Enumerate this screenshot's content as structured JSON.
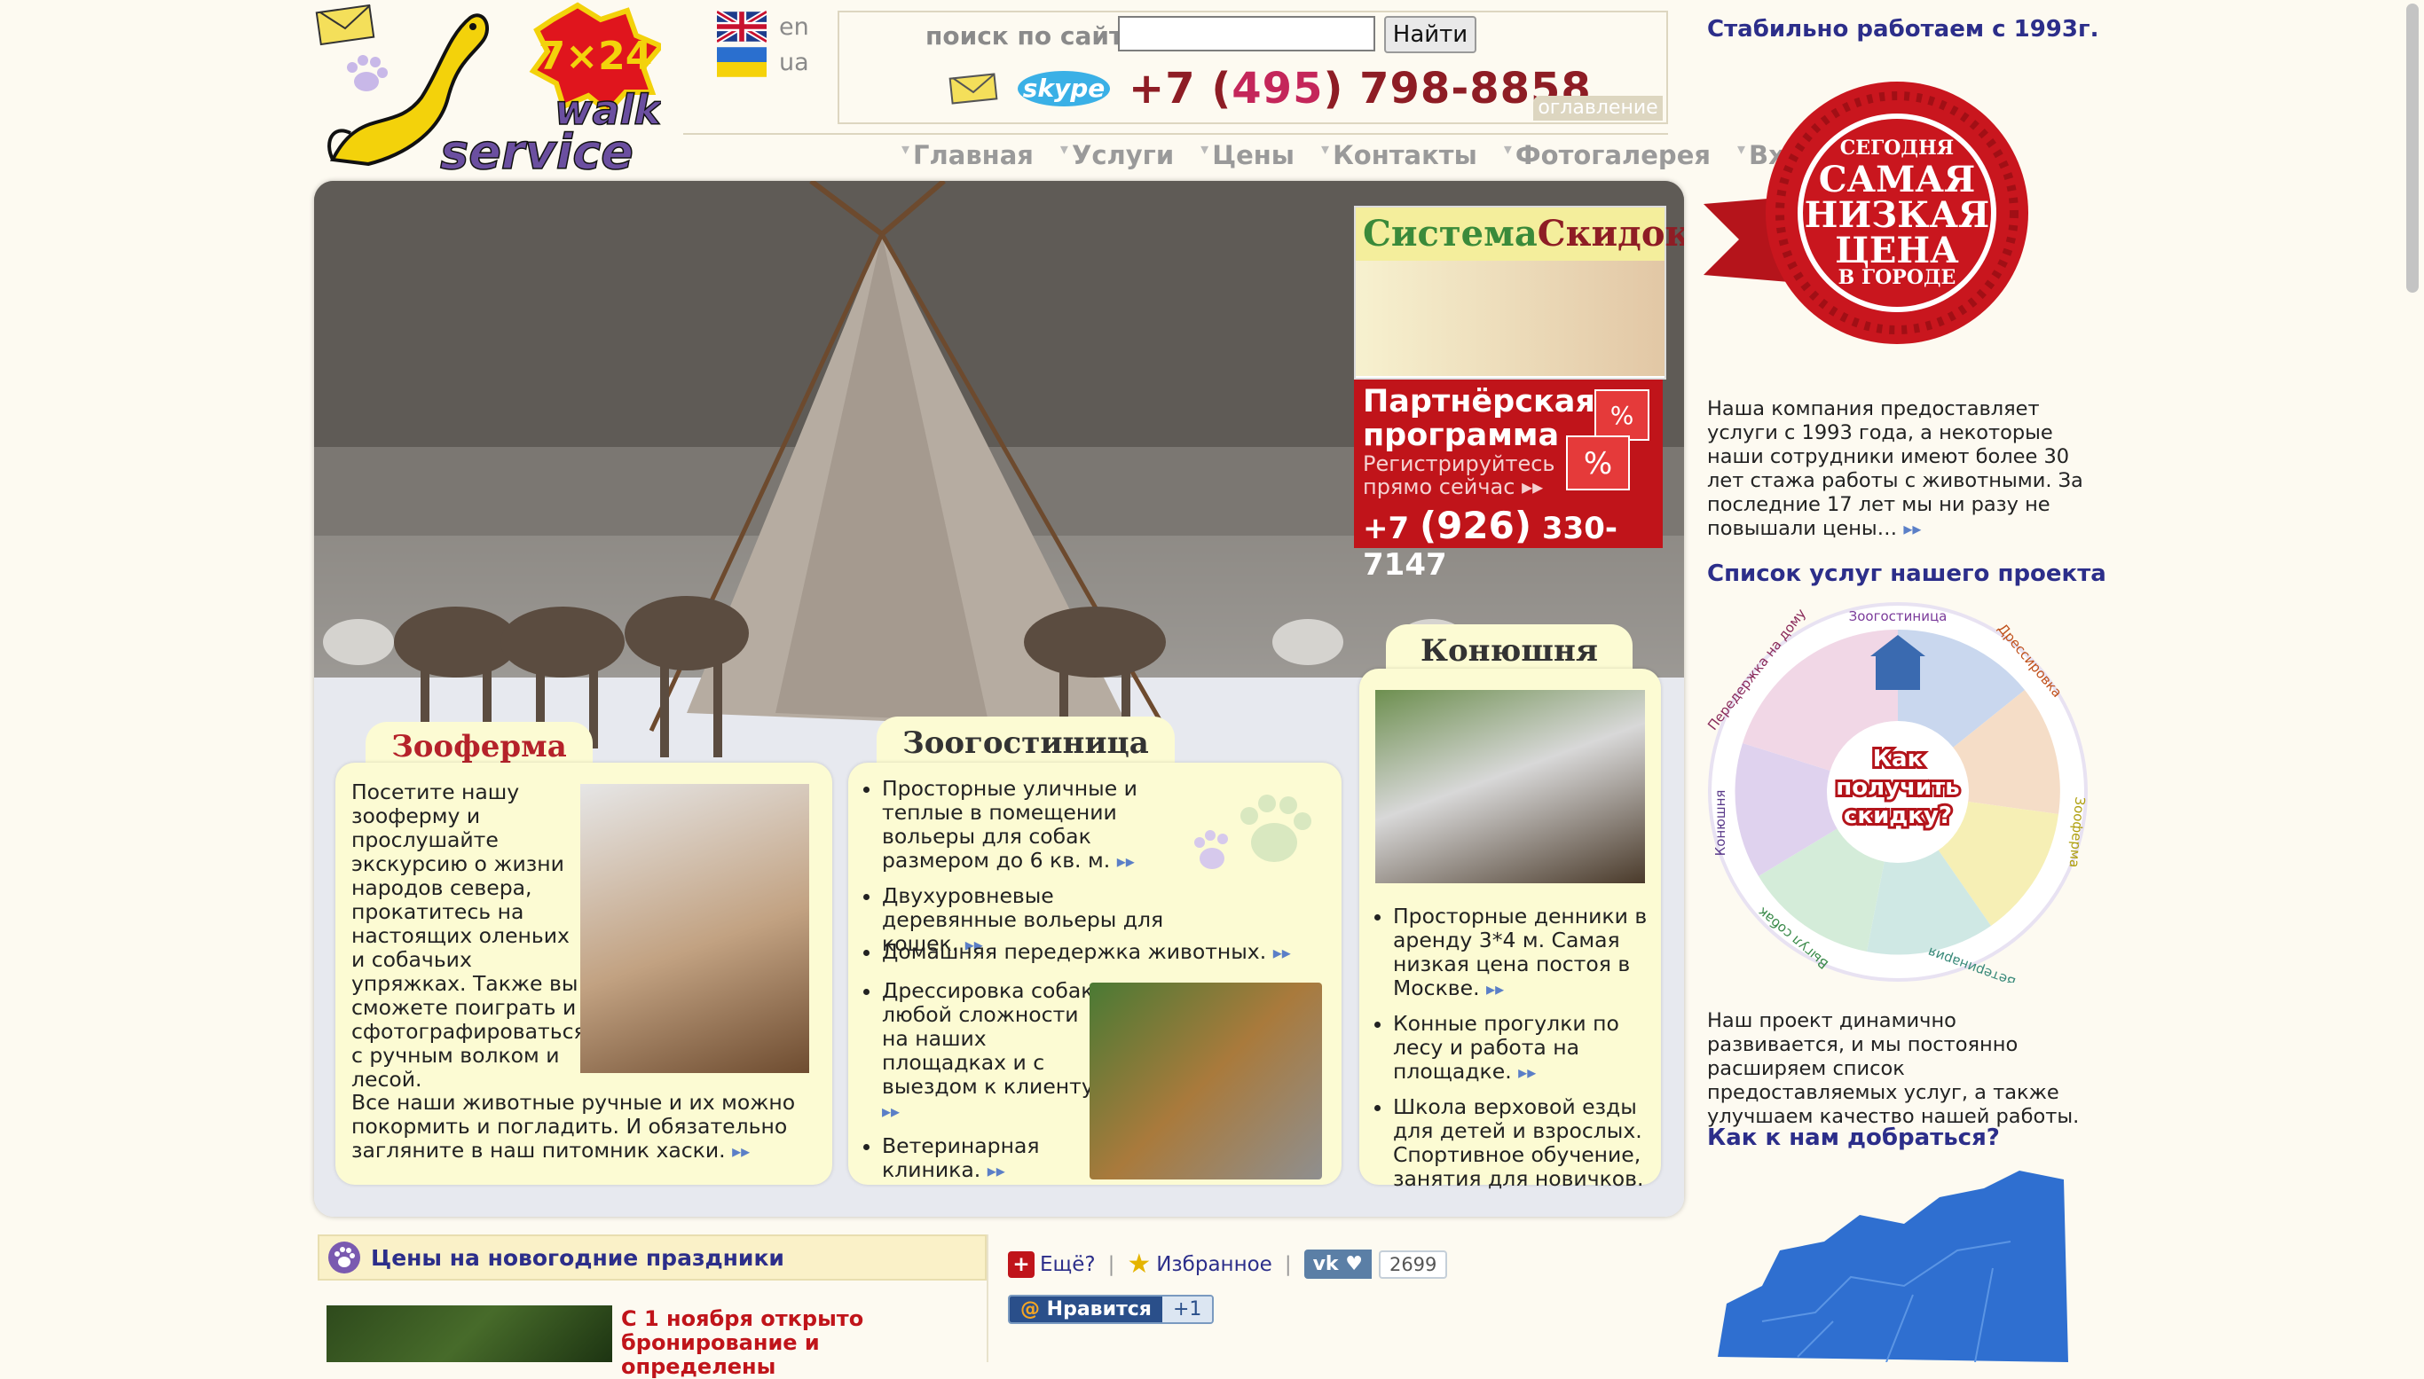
{
  "logo": {
    "badge": "7×24",
    "word1": "walk",
    "word2": "service"
  },
  "languages": [
    "en",
    "ua"
  ],
  "search": {
    "label": "поиск по сайту",
    "button": "Найти",
    "value": ""
  },
  "phone": {
    "prefix": "+7 (",
    "code": "495",
    "rest": ") 798-8858"
  },
  "contents_tab": "оглавление",
  "nav": [
    "Главная",
    "Услуги",
    "Цены",
    "Контакты",
    "Фотогалерея",
    "Вход"
  ],
  "promo_discount": {
    "title_a": "Система",
    "title_b": "Скидок"
  },
  "promo_partner": {
    "line1": "Партнёрская",
    "line2": "программа",
    "line3": "Регистрируйтесь",
    "line4": "прямо сейчас",
    "phone_a": "+7 ",
    "phone_b": "(926)",
    "phone_c": " 330-7147"
  },
  "zooferma": {
    "title": "Зооферма",
    "text": "Посетите нашу зооферму и прослушайте экскурсию о жизни народов севера, прокатитесь на настоящих оленьих и собачьих упряжках. Также вы сможете поиграть и сфотографироваться с ручным волком и лесой.",
    "text2": "Все наши животные ручные и их можно покормить и погладить. И обязательно загляните в наш питомник хаски."
  },
  "hotel": {
    "title": "Зоогостиница",
    "items": [
      "Просторные уличные и теплые в помещении вольеры для собак размером до 6 кв. м.",
      "Двухуровневые деревянные вольеры для кошек.",
      "Домашняя передержка животных."
    ],
    "items2": [
      "Дрессировка собак любой сложности на наших площадках и с выездом к клиенту.",
      "Ветеринарная клиника."
    ]
  },
  "stable": {
    "title": "Конюшня",
    "items": [
      "Просторные денники в аренду 3*4 м. Самая низкая цена постоя в Москве.",
      "Конные прогулки по лесу и работа на площадке.",
      "Школа верховой езды для детей и взрослых. Спортивное обучение, занятия для новичков."
    ]
  },
  "right": {
    "since": "Стабильно работаем с 1993г.",
    "rosette": [
      "СЕГОДНЯ",
      "САМАЯ",
      "НИЗКАЯ",
      "ЦЕНА",
      "В ГОРОДЕ"
    ],
    "about": "Наша компания предоставляет услуги с 1993 года, а некоторые наши сотрудники имеют более 30 лет стажа работы с животными. За последние 17 лет мы ни разу не повышали цены…",
    "services_title": "Список услуг нашего проекта",
    "wheel_center": [
      "Как",
      "получить",
      "скидку?"
    ],
    "wheel_labels": [
      "Зоогостиница",
      "Дрессировка",
      "Зооферма",
      "Ветеринария",
      "Выгул собак",
      "Конюшня",
      "Передержка на дому"
    ],
    "develop": "Наш проект динамично развивается, и мы постоянно расширяем список предоставляемых услуг, а также улучшаем качество нашей работы.",
    "route_title": "Как к нам добраться?"
  },
  "bottom": {
    "prices_title": "Цены на новогодние праздники",
    "news": "С 1 ноября открыто бронирование и определены",
    "more": "Ещё?",
    "favorites": "Избранное",
    "vk_count": "2699",
    "like": "Нравится",
    "plus": "+1"
  },
  "colors": {
    "accent_red": "#8e1d25",
    "heading_blue": "#2c2e8a",
    "card_bg": "#fcfbd3",
    "nav_grey": "#9a9a9a"
  }
}
